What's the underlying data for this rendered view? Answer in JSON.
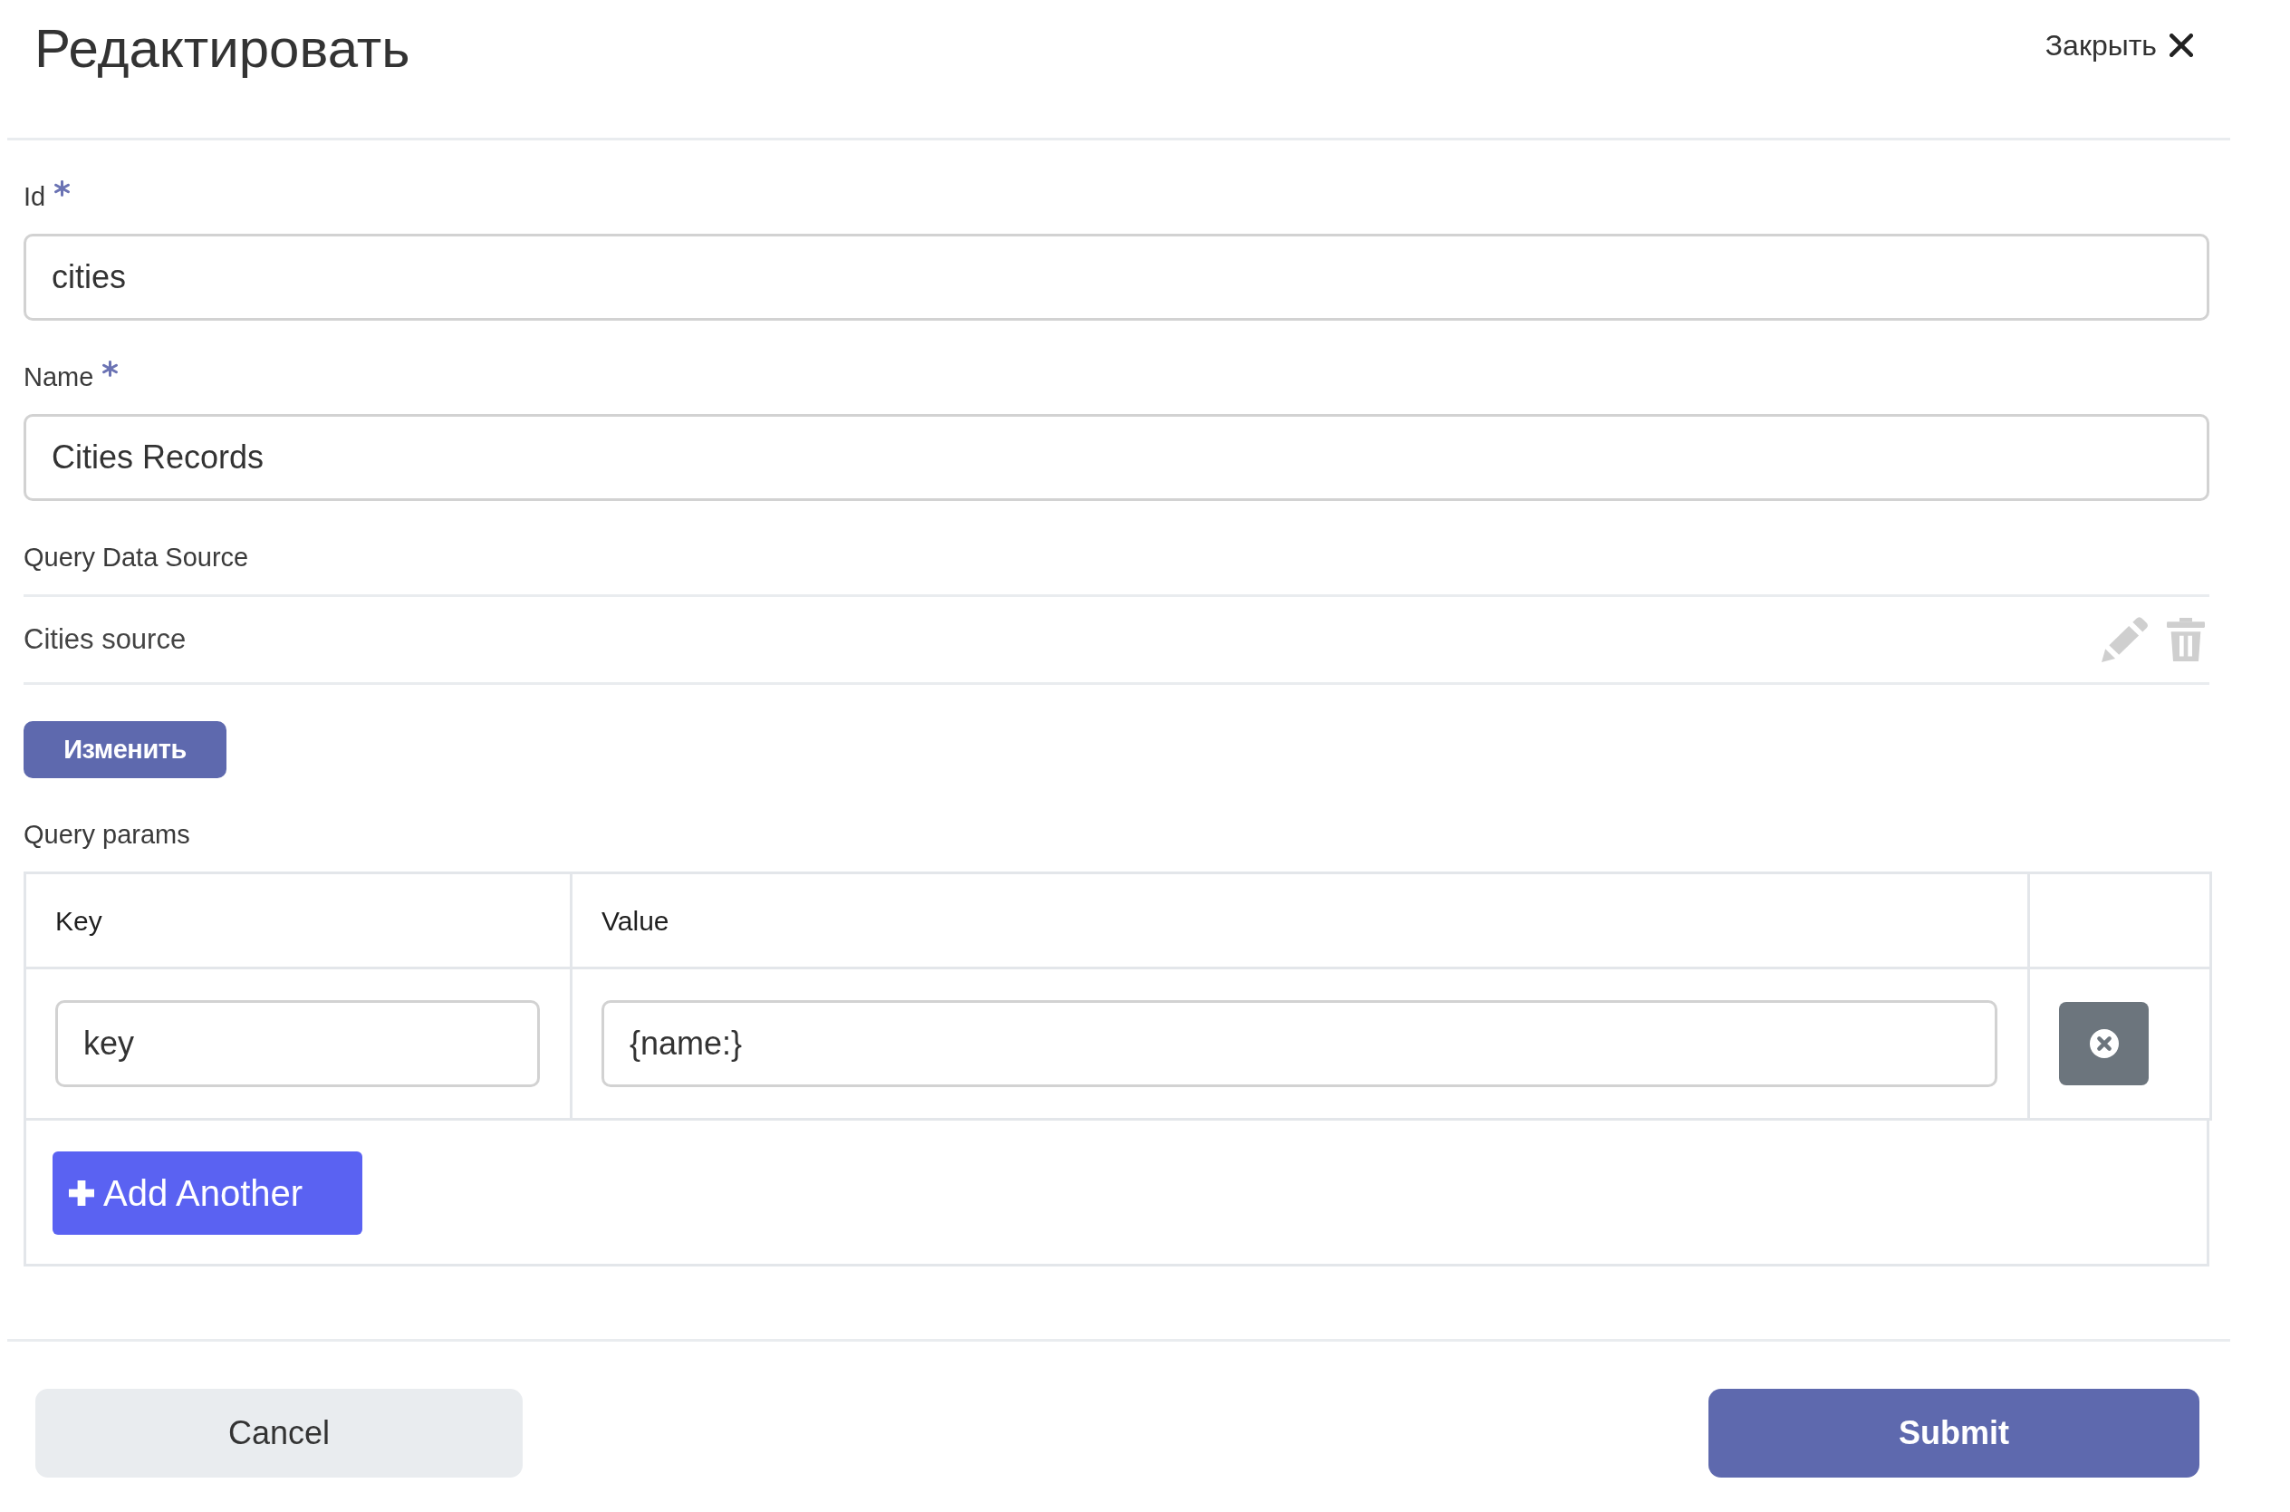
{
  "header": {
    "title": "Редактировать",
    "close_label": "Закрыть"
  },
  "fields": [
    {
      "label": "Id",
      "required": true,
      "value": "cities"
    },
    {
      "label": "Name",
      "required": true,
      "value": "Cities Records"
    }
  ],
  "query_data_source": {
    "label": "Query Data Source",
    "items": [
      {
        "name": "Cities source"
      }
    ],
    "change_button": "Изменить"
  },
  "query_params": {
    "label": "Query params",
    "columns": [
      "Key",
      "Value"
    ],
    "rows": [
      {
        "key": "key",
        "value": "{name:}"
      }
    ],
    "add_button": "Add Another"
  },
  "footer": {
    "buttons": [
      {
        "label": "Cancel",
        "kind": "secondary"
      },
      {
        "label": "Submit",
        "kind": "primary"
      }
    ]
  }
}
